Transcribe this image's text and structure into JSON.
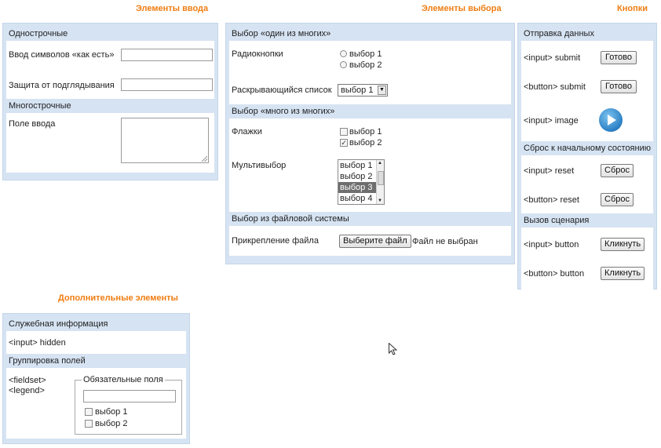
{
  "headings": {
    "input_elements": "Элементы ввода",
    "select_elements": "Элементы выбора",
    "buttons": "Кнопки",
    "extra_elements": "Дополнительные элементы"
  },
  "input_panel": {
    "single_line_head": "Однострочные",
    "as_is_label": "Ввод символов «как есть»",
    "as_is_value": "",
    "password_label": "Защита от подглядывания",
    "password_value": "",
    "multi_line_head": "Многострочные",
    "textarea_label": "Поле ввода",
    "textarea_value": ""
  },
  "select_panel": {
    "one_of_many_head": "Выбор «один из многих»",
    "radio_label": "Радиокнопки",
    "radio_options": [
      "выбор 1",
      "выбор 2"
    ],
    "dropdown_label": "Раскрывающийся список",
    "dropdown_value": "выбор 1",
    "many_of_many_head": "Выбор «много из многих»",
    "checkbox_label": "Флажки",
    "checkbox_options": [
      "выбор 1",
      "выбор 2"
    ],
    "checkbox_checked_mark": "✓",
    "multiselect_label": "Мультивыбор",
    "multiselect_options": [
      "выбор 1",
      "выбор 2",
      "выбор 3",
      "выбор 4"
    ],
    "multiselect_selected": "выбор 3",
    "file_head": "Выбор из файловой системы",
    "file_label": "Прикрепление файла",
    "file_button": "Выберите файл",
    "file_status": "Файл не выбран"
  },
  "buttons_panel": {
    "submit_head": "Отправка данных",
    "input_submit_label": "<input> submit",
    "input_submit_button": "Готово",
    "button_submit_label": "<button> submit",
    "button_submit_button": "Готово",
    "input_image_label": "<input> image",
    "reset_head": "Сброс к начальному состоянию",
    "input_reset_label": "<input> reset",
    "input_reset_button": "Сброс",
    "button_reset_label": "<button> reset",
    "button_reset_button": "Сброс",
    "script_head": "Вызов сценария",
    "input_button_label": "<input> button",
    "input_button_button": "Кликнуть",
    "button_button_label": "<button> button",
    "button_button_button": "Кликнуть"
  },
  "extra_panel": {
    "service_head": "Служебная информация",
    "hidden_label": "<input> hidden",
    "grouping_head": "Группировка полей",
    "fieldset_label": "<fieldset>",
    "legend_label": "<legend>",
    "legend_text": "Обязательные поля",
    "field_value": "",
    "checkbox_options": [
      "выбор 1",
      "выбор 2"
    ]
  },
  "colors": {
    "heading_orange": "#f07d12",
    "panel_blue": "#d6e3f2"
  }
}
